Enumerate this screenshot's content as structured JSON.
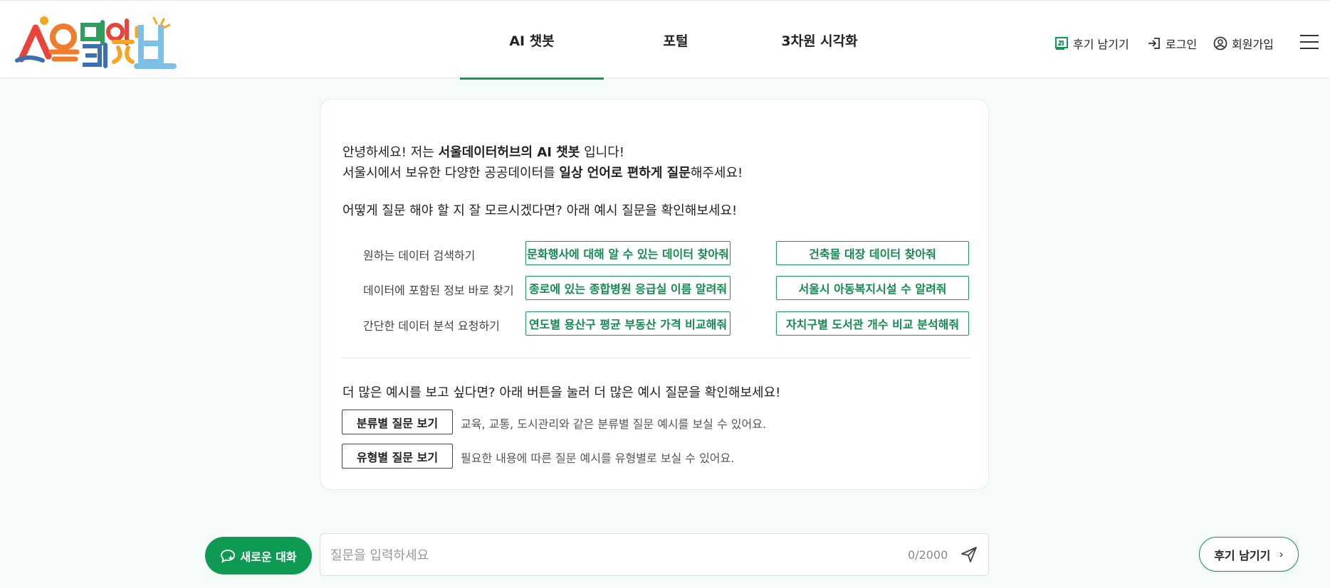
{
  "header": {
    "logo_alt": "서울데이터허브",
    "tabs": [
      {
        "label": "AI 챗봇",
        "active": true
      },
      {
        "label": "포털",
        "active": false
      },
      {
        "label": "3차원 시각화",
        "active": false
      }
    ],
    "review_label": "후기 남기기",
    "login_label": "로그인",
    "signup_label": "회원가입"
  },
  "card": {
    "intro_line1_a": "안녕하세요! 저는 ",
    "intro_line1_b": "서울데이터허브의 AI 챗봇",
    "intro_line1_c": " 입니다!",
    "intro_line2_a": "서울시에서 보유한 다양한 공공데이터를 ",
    "intro_line2_b": "일상 언어로 편하게 질문",
    "intro_line2_c": "해주세요!",
    "question_hint": "어떻게 질문 해야 할 지 잘 모르시겠다면? 아래 예시 질문을 확인해보세요!",
    "examples": [
      {
        "label": "원하는 데이터 검색하기",
        "buttons": [
          "문화행사에 대해 알 수 있는 데이터 찾아줘",
          "건축물 대장 데이터 찾아줘"
        ]
      },
      {
        "label": "데이터에 포함된 정보 바로 찾기",
        "buttons": [
          "종로에 있는 종합병원 응급실 이름 알려줘",
          "서울시 아동복지시설 수 알려줘"
        ]
      },
      {
        "label": "간단한 데이터 분석 요청하기",
        "buttons": [
          "연도별 용산구 평균 부동산 가격 비교해줘",
          "자치구별 도서관 개수 비교 분석해줘"
        ]
      }
    ],
    "more_hint": "더 많은 예시를 보고 싶다면? 아래 버튼을 눌러 더 많은 예시 질문을 확인해보세요!",
    "category_btn": "분류별 질문 보기",
    "category_desc": "교육, 교통, 도시관리와 같은 분류별 질문 예시를 보실 수 있어요.",
    "type_btn": "유형별 질문 보기",
    "type_desc": "필요한 내용에 따른 질문 예시를 유형별로 보실 수 있어요."
  },
  "bottom": {
    "new_chat_label": "새로운 대화",
    "input_placeholder": "질문을 입력하세요",
    "char_count": "0/2000",
    "review_label": "후기 남기기"
  },
  "colors": {
    "accent": "#0e9a53",
    "background": "#f4fbf8"
  }
}
